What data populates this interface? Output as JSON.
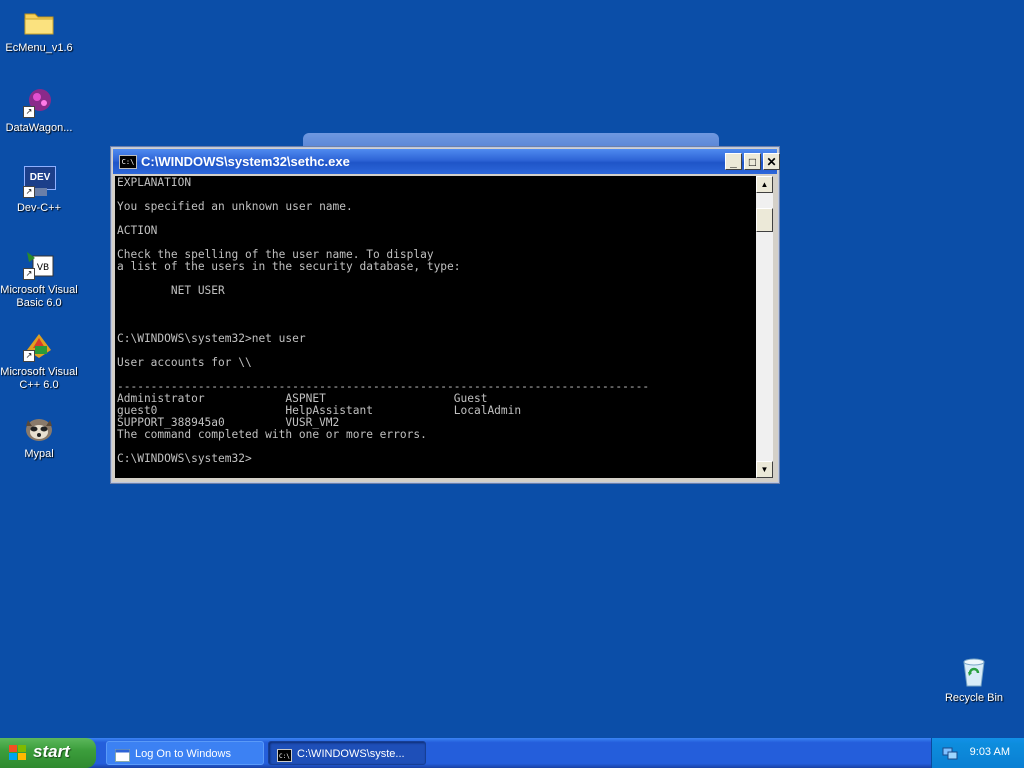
{
  "desktop": {
    "icons": [
      {
        "label": "EcMenu_v1.6",
        "icon": "folder-icon"
      },
      {
        "label": "DataWagon...",
        "icon": "datawagon-icon"
      },
      {
        "label": "Dev-C++",
        "icon": "devcpp-icon",
        "badge": "DEV"
      },
      {
        "label": "Microsoft Visual Basic 6.0",
        "icon": "vb6-icon"
      },
      {
        "label": "Microsoft Visual C++ 6.0",
        "icon": "vcpp-icon"
      },
      {
        "label": "Mypal",
        "icon": "raccoon-icon"
      },
      {
        "label": "Recycle Bin",
        "icon": "recycle-bin-icon"
      }
    ]
  },
  "cmd_window": {
    "title": "C:\\WINDOWS\\system32\\sethc.exe",
    "icon_text": "C:\\",
    "buttons": {
      "minimize": "_",
      "maximize": "□",
      "close": "✕"
    },
    "console_lines": [
      "EXPLANATION",
      "",
      "You specified an unknown user name.",
      "",
      "ACTION",
      "",
      "Check the spelling of the user name. To display",
      "a list of the users in the security database, type:",
      "",
      "        NET USER",
      "",
      "",
      "",
      "C:\\WINDOWS\\system32>net user",
      "",
      "User accounts for \\\\",
      "",
      "-------------------------------------------------------------------------------",
      "Administrator            ASPNET                   Guest",
      "guest0                   HelpAssistant            LocalAdmin",
      "SUPPORT_388945a0         VUSR_VM2",
      "The command completed with one or more errors.",
      "",
      "C:\\WINDOWS\\system32>"
    ]
  },
  "taskbar": {
    "start_label": "start",
    "tasks": [
      {
        "label": "Log On to Windows",
        "icon": "window-icon"
      },
      {
        "label": "C:\\WINDOWS\\syste...",
        "icon": "console-icon"
      }
    ],
    "clock": "9:03 AM",
    "tray_icon": "network-icon"
  },
  "colors": {
    "desktop": "#0b4ea8",
    "console_text": "#c0c0c0",
    "titlebar": "#2e64d6",
    "start_button": "#3c9e3c"
  }
}
